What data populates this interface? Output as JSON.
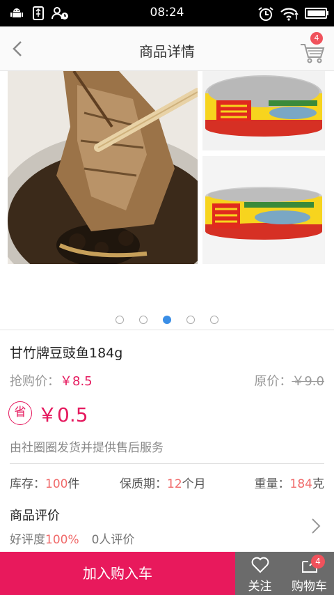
{
  "status_bar": {
    "time": "08:24"
  },
  "header": {
    "title": "商品详情",
    "cart_badge": "4"
  },
  "gallery": {
    "slide_count": 5,
    "active_index": 2
  },
  "product": {
    "name": "甘竹牌豆豉鱼184g",
    "sale_label": "抢购价：",
    "sale_price": "￥8.5",
    "orig_label": "原价：",
    "orig_price": "￥9.0",
    "save_badge": "省",
    "save_amount": "￥0.5",
    "service_note": "由社圈圈发货并提供售后服务"
  },
  "specs": {
    "stock_label": "库存：",
    "stock_num": "100",
    "stock_unit": "件",
    "shelf_label": "保质期：",
    "shelf_num": "12",
    "shelf_unit": "个月",
    "weight_label": "重量：",
    "weight_num": "184",
    "weight_unit": "克"
  },
  "review": {
    "title": "商品评价",
    "rate_label": "好评度",
    "rate_value": "100%",
    "count_text": "0人评价"
  },
  "bottom_bar": {
    "add_cart": "加入购入车",
    "follow": "关注",
    "cart": "购物车",
    "cart_badge": "4"
  },
  "colors": {
    "accent": "#e8195c",
    "price": "#e5195e",
    "highlight": "#f06a6a",
    "bar_gray": "#6b6b6b"
  }
}
